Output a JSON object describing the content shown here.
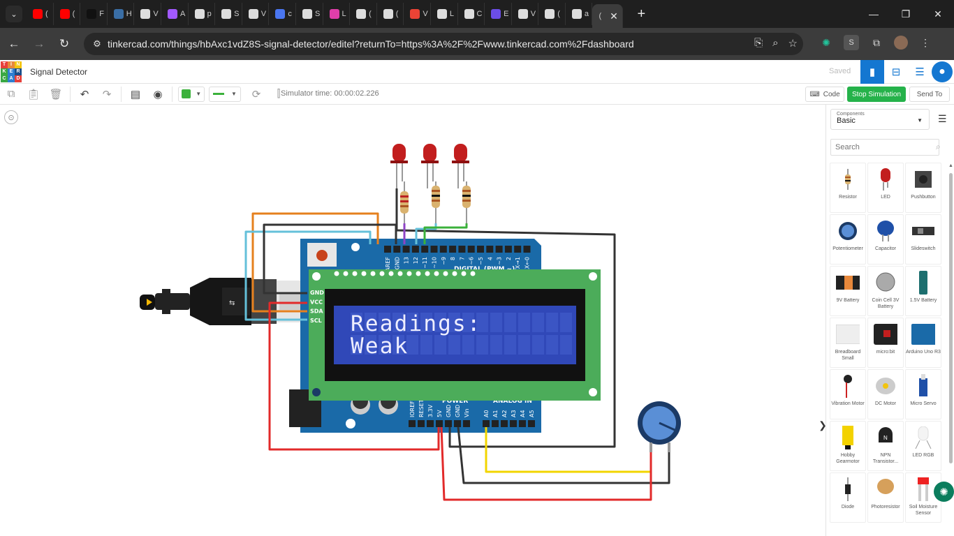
{
  "browser": {
    "tabs": [
      {
        "icon": "youtube-icon",
        "color": "#ff0000",
        "label": "("
      },
      {
        "icon": "youtube-icon",
        "color": "#ff0000",
        "label": "("
      },
      {
        "icon": "r-app-icon",
        "color": "#111111",
        "label": "F"
      },
      {
        "icon": "globe-icon",
        "color": "#3a6ea5",
        "label": "H"
      },
      {
        "icon": "openai-icon",
        "color": "#dddddd",
        "label": "V"
      },
      {
        "icon": "figma-icon",
        "color": "#a259ff",
        "label": "A"
      },
      {
        "icon": "chrome-icon",
        "color": "#dddddd",
        "label": "p"
      },
      {
        "icon": "diamond-icon",
        "color": "#dddddd",
        "label": "S"
      },
      {
        "icon": "diamond-icon",
        "color": "#dddddd",
        "label": "V"
      },
      {
        "icon": "meet-icon",
        "color": "#4a76f0",
        "label": "c"
      },
      {
        "icon": "openai-icon",
        "color": "#dddddd",
        "label": "S"
      },
      {
        "icon": "heart-icon",
        "color": "#e03eaa",
        "label": "L"
      },
      {
        "icon": "m-logo-icon",
        "color": "#dddddd",
        "label": "("
      },
      {
        "icon": "m-logo-icon",
        "color": "#dddddd",
        "label": "("
      },
      {
        "icon": "gmail-icon",
        "color": "#ea4335",
        "label": "V"
      },
      {
        "icon": "diamond-icon",
        "color": "#dddddd",
        "label": "L"
      },
      {
        "icon": "codepen-icon",
        "color": "#dddddd",
        "label": "C"
      },
      {
        "icon": "check-icon",
        "color": "#6b4de6",
        "label": "E"
      },
      {
        "icon": "github-icon",
        "color": "#dddddd",
        "label": "V"
      },
      {
        "icon": "github-icon",
        "color": "#dddddd",
        "label": "("
      },
      {
        "icon": "globe-icon",
        "color": "#dddddd",
        "label": "a"
      }
    ],
    "active_tab_label": "(",
    "url": "tinkercad.com/things/hbAxc1vdZ8S-signal-detector/editel?returnTo=https%3A%2F%2Fwww.tinkercad.com%2Fdashboard"
  },
  "app": {
    "logo_letters": [
      "T",
      "I",
      "N",
      "K",
      "E",
      "R",
      "C",
      "A",
      "D"
    ],
    "title": "Signal Detector",
    "saved": "Saved"
  },
  "toolbar": {
    "sim_time": "Simulator time: 00:00:02.226",
    "code_label": "Code",
    "stop_label": "Stop Simulation",
    "send_label": "Send To",
    "accent": "#25b24a"
  },
  "circuit": {
    "lcd_line1": "Readings:",
    "lcd_line2": "Weak",
    "i2c_pins": [
      "GND",
      "VCC",
      "SDA",
      "SCL"
    ],
    "digital_pins": [
      "AREF",
      "GND",
      "13",
      "12",
      "~11",
      "~10",
      "~9",
      "8",
      "7",
      "~6",
      "~5",
      "4",
      "~3",
      "2",
      "TX→1",
      "RX←0"
    ],
    "digital_label": "DIGITAL (PWM ~)",
    "power_pins": [
      "IOREF",
      "RESET",
      "3.3V",
      "5V",
      "GND",
      "GND",
      "Vin"
    ],
    "analog_pins": [
      "A0",
      "A1",
      "A2",
      "A3",
      "A4",
      "A5"
    ],
    "power_label": "POWER",
    "analog_label": "ANALOG IN"
  },
  "panel": {
    "components_label": "Components",
    "category": "Basic",
    "search_placeholder": "Search",
    "items": [
      {
        "name": "Resistor",
        "icon": "resistor-icon"
      },
      {
        "name": "LED",
        "icon": "led-icon"
      },
      {
        "name": "Pushbutton",
        "icon": "pushbutton-icon"
      },
      {
        "name": "Potentiometer",
        "icon": "potentiometer-icon"
      },
      {
        "name": "Capacitor",
        "icon": "capacitor-icon"
      },
      {
        "name": "Slideswitch",
        "icon": "slideswitch-icon"
      },
      {
        "name": "9V Battery",
        "icon": "battery-9v-icon"
      },
      {
        "name": "Coin Cell 3V Battery",
        "icon": "coin-cell-icon"
      },
      {
        "name": "1.5V Battery",
        "icon": "battery-aa-icon"
      },
      {
        "name": "Breadboard Small",
        "icon": "breadboard-icon"
      },
      {
        "name": "micro:bit",
        "icon": "microbit-icon"
      },
      {
        "name": "Arduino Uno R3",
        "icon": "arduino-icon"
      },
      {
        "name": "Vibration Motor",
        "icon": "vibration-motor-icon"
      },
      {
        "name": "DC Motor",
        "icon": "dc-motor-icon"
      },
      {
        "name": "Micro Servo",
        "icon": "servo-icon"
      },
      {
        "name": "Hobby Gearmotor",
        "icon": "gearmotor-icon"
      },
      {
        "name": "NPN Transistor...",
        "icon": "transistor-icon"
      },
      {
        "name": "LED RGB",
        "icon": "led-rgb-icon"
      },
      {
        "name": "Diode",
        "icon": "diode-icon"
      },
      {
        "name": "Photoresistor",
        "icon": "photoresistor-icon"
      },
      {
        "name": "Soil Moisture Sensor",
        "icon": "soil-sensor-icon"
      }
    ]
  }
}
